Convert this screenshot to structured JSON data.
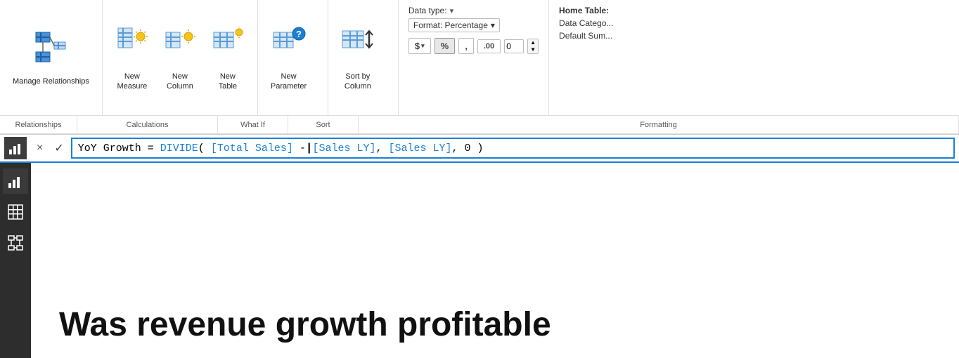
{
  "ribbon": {
    "sections": [
      {
        "id": "relationships",
        "buttons": [
          {
            "id": "manage-relationships",
            "label": "Manage\nRelationships",
            "icon": "manage-rel-icon"
          }
        ],
        "label": "Relationships"
      },
      {
        "id": "calculations",
        "buttons": [
          {
            "id": "new-measure",
            "label": "New\nMeasure",
            "icon": "measure-icon"
          },
          {
            "id": "new-column",
            "label": "New\nColumn",
            "icon": "column-icon"
          },
          {
            "id": "new-table",
            "label": "New\nTable",
            "icon": "table-icon"
          }
        ],
        "label": "Calculations"
      },
      {
        "id": "whatif",
        "buttons": [
          {
            "id": "new-parameter",
            "label": "New\nParameter",
            "icon": "param-icon"
          }
        ],
        "label": "What If"
      },
      {
        "id": "sort",
        "buttons": [
          {
            "id": "sort-by-column",
            "label": "Sort by\nColumn",
            "icon": "sort-icon"
          }
        ],
        "label": "Sort"
      }
    ],
    "formatting": {
      "data_type_label": "Data type:",
      "format_label": "Format: Percentage",
      "format_dropdown_arrow": "▾",
      "currency_symbol": "$",
      "percent_symbol": "%",
      "comma_symbol": ",",
      "decimal_label": ".00",
      "decimal_value": "0",
      "section_label": "Formatting"
    },
    "home_table": {
      "title": "Home Table:",
      "data_category": "Data Catego...",
      "default_sum": "Default Sum..."
    }
  },
  "formula_bar": {
    "cancel_label": "×",
    "confirm_label": "✓",
    "formula_prefix": "YoY Growth = DIVIDE( [Total Sales] -",
    "formula_suffix": "[Sales LY], [Sales LY], 0 )",
    "cursor_char": "|"
  },
  "sidebar": {
    "items": [
      {
        "id": "bar-chart",
        "icon": "📊",
        "active": true
      },
      {
        "id": "table-view",
        "icon": "⊞",
        "active": false
      },
      {
        "id": "model-view",
        "icon": "⊟",
        "active": false
      }
    ]
  },
  "main": {
    "title": "Was revenue growth profitable"
  }
}
